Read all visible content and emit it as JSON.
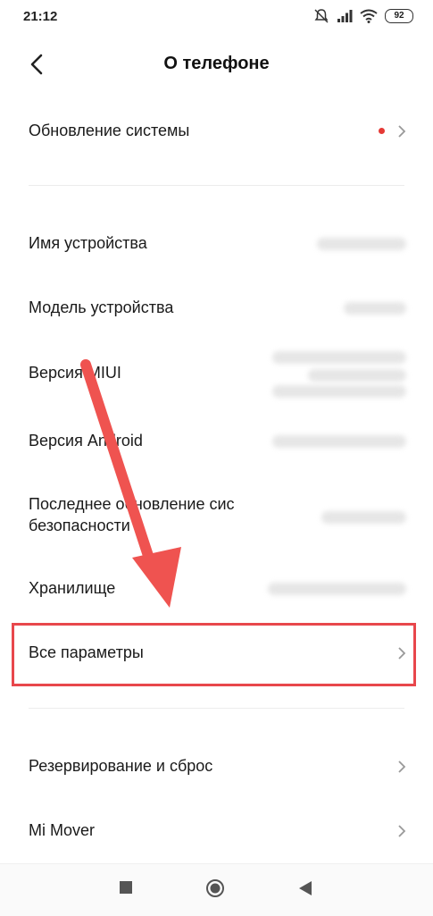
{
  "status": {
    "time": "21:12",
    "battery": "92"
  },
  "header": {
    "title": "О телефоне"
  },
  "rows": {
    "system_update": "Обновление системы",
    "device_name": "Имя устройства",
    "device_model": "Модель устройства",
    "miui_version": "Версия MIUI",
    "android_version": "Версия Android",
    "security_update_line1": "Последнее обновление сис",
    "security_update_line2": "безопасности",
    "storage": "Хранилище",
    "all_params": "Все параметры",
    "backup": "Резервирование и сброс",
    "mi_mover": "Mi Mover"
  },
  "colors": {
    "update_dot": "#e53935",
    "highlight": "#e8474c",
    "arrow": "#ef5350"
  },
  "icons": [
    "back-icon",
    "chevron-right-icon",
    "mute-icon",
    "signal-icon",
    "wifi-icon",
    "battery-icon",
    "recents-icon",
    "home-icon",
    "back-nav-icon"
  ]
}
